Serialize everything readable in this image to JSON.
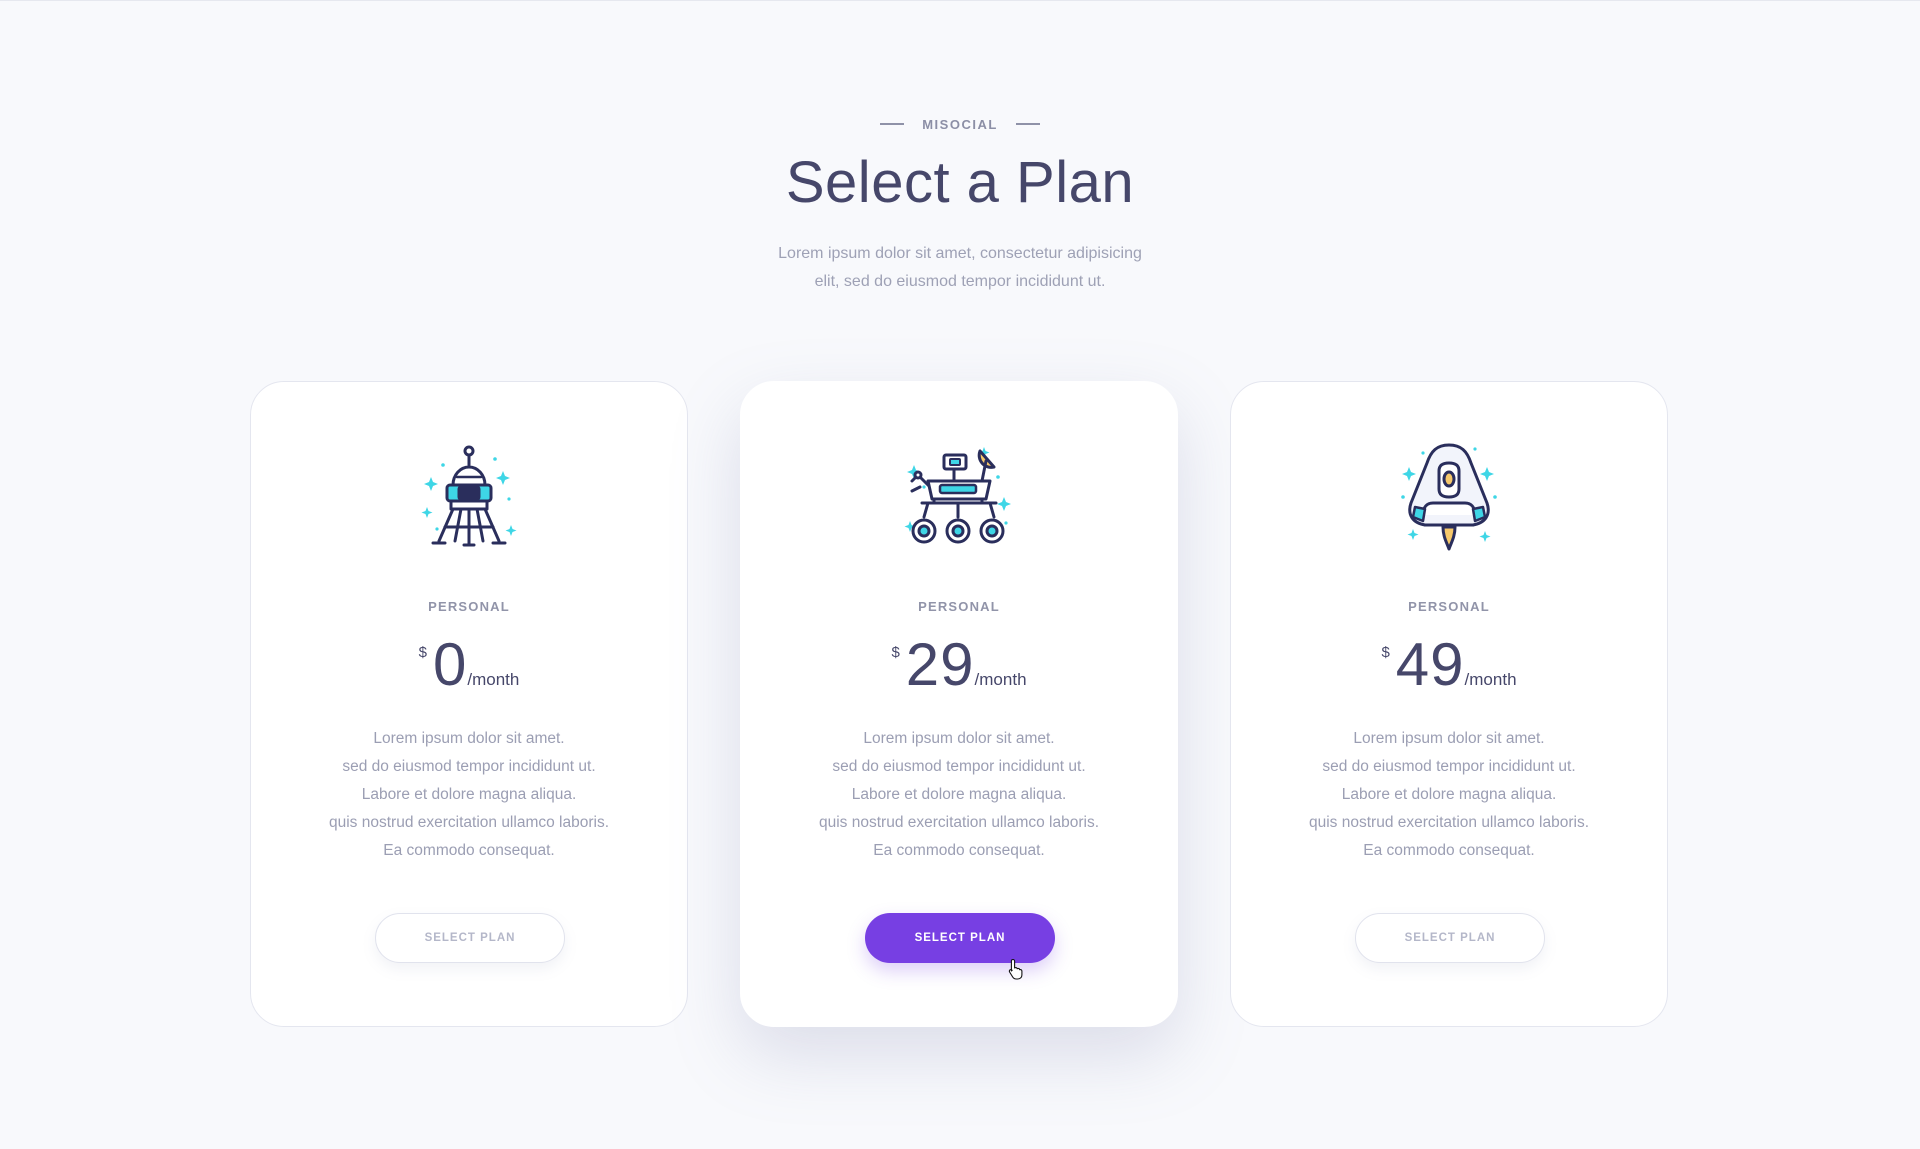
{
  "header": {
    "eyebrow": "MISOCIAL",
    "title": "Select a Plan",
    "subtitle_lines": [
      "Lorem ipsum dolor sit amet, consectetur adipisicing",
      "elit, sed do eiusmod tempor incididunt ut."
    ]
  },
  "plans": [
    {
      "icon": "lunar-lander-icon",
      "name": "PERSONAL",
      "currency": "$",
      "amount": "0",
      "period": "/month",
      "features": [
        "Lorem ipsum dolor sit amet.",
        "sed do eiusmod tempor incididunt ut.",
        "Labore et dolore magna aliqua.",
        "quis nostrud exercitation ullamco laboris.",
        "Ea commodo consequat."
      ],
      "button_label": "SELECT PLAN",
      "featured": false
    },
    {
      "icon": "mars-rover-icon",
      "name": "PERSONAL",
      "currency": "$",
      "amount": "29",
      "period": "/month",
      "features": [
        "Lorem ipsum dolor sit amet.",
        "sed do eiusmod tempor incididunt ut.",
        "Labore et dolore magna aliqua.",
        "quis nostrud exercitation ullamco laboris.",
        "Ea commodo consequat."
      ],
      "button_label": "SELECT PLAN",
      "featured": true
    },
    {
      "icon": "space-capsule-icon",
      "name": "PERSONAL",
      "currency": "$",
      "amount": "49",
      "period": "/month",
      "features": [
        "Lorem ipsum dolor sit amet.",
        "sed do eiusmod tempor incididunt ut.",
        "Labore et dolore magna aliqua.",
        "quis nostrud exercitation ullamco laboris.",
        "Ea commodo consequat."
      ],
      "button_label": "SELECT PLAN",
      "featured": false
    }
  ],
  "colors": {
    "background": "#f8f9fc",
    "heading": "#46476a",
    "muted_text": "#9b9eb3",
    "accent": "#773fe3",
    "icon_line": "#2a2e5c",
    "icon_cyan": "#3ed6e6",
    "icon_yellow": "#f6c86b"
  }
}
